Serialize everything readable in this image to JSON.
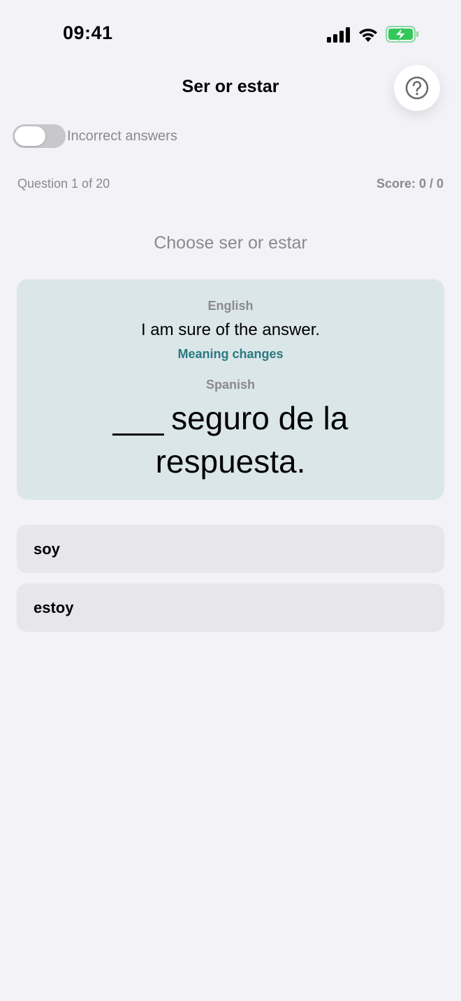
{
  "status_bar": {
    "time": "09:41",
    "icons": [
      "cellular-signal-icon",
      "wifi-icon",
      "battery-charging-icon"
    ],
    "battery_color": "#34c759"
  },
  "nav": {
    "title": "Ser or estar",
    "help_icon": "question-circle-icon"
  },
  "toggle": {
    "label": "Incorrect answers",
    "on": false
  },
  "progress": {
    "question": "Question 1 of 20",
    "score": "Score: 0 / 0"
  },
  "instruction": "Choose ser or estar",
  "card": {
    "english_label": "English",
    "english_text": "I am sure of the answer.",
    "meaning_tag": "Meaning changes",
    "spanish_label": "Spanish",
    "spanish_blank": "___",
    "spanish_text": " seguro de la respuesta.",
    "background": "#dbe6e8",
    "accent": "#2a7a82"
  },
  "options": [
    {
      "label": "soy"
    },
    {
      "label": "estoy"
    }
  ]
}
